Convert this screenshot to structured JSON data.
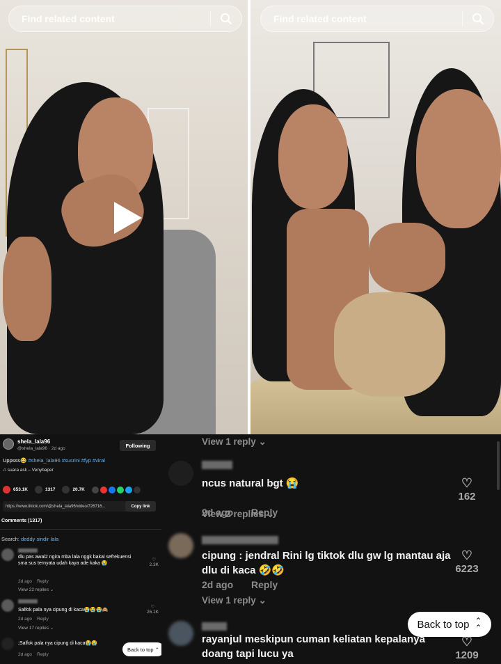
{
  "search": {
    "placeholder": "Find related content"
  },
  "post": {
    "username": "shela_lala96",
    "handle_line": "@shela_lala96 · 2d ago",
    "follow_label": "Following",
    "caption_text": "Uppsss",
    "caption_tags": "#shela_lala96 #susrini #fyp #viral",
    "sound": "suara asli – Venybaper",
    "likes": "653.1K",
    "comments": "1317",
    "saves": "20.7K",
    "link": "https://www.tiktok.com/@shela_lala96/video/726716...",
    "copy_label": "Copy link",
    "comments_heading": "Comments (1317)",
    "search_prefix": "Search:",
    "search_query": "deddy sindir lala"
  },
  "small_comments": [
    {
      "text": "dlu pas awal2 ngira mba lala nggk bakal sefrekuensi sma sus ternyata udah kaya ade kaka 😭",
      "date": "2d ago",
      "reply": "Reply",
      "replies": "View 22 replies ⌄",
      "likes": "2.3K"
    },
    {
      "text": "Salfok pala nya cipung di kaca😭😭😭🙈",
      "date": "2d ago",
      "reply": "Reply",
      "replies": "View 17 replies ⌄",
      "likes": "26.1K"
    },
    {
      "text": ";Salfok pala nya cipung di kaca😭😭",
      "date": "2d ago",
      "reply": "Reply",
      "replies": "",
      "likes": ""
    }
  ],
  "back_to_top_small": "Back to top ⌃",
  "zoom": {
    "top_replies": "View 1 reply ⌄",
    "comments": [
      {
        "text": "ncus natural bgt 😭",
        "date": "2d ago",
        "reply": "Reply",
        "likes": "162",
        "replies": "View 2 replies ⌄"
      },
      {
        "text": "cipung : jendral Rini lg tiktok dlu gw lg mantau aja dlu di kaca 🤣🤣",
        "date": "2d ago",
        "reply": "Reply",
        "likes": "6223",
        "replies": "View 1 reply ⌄"
      },
      {
        "text": "rayanjul meskipun cuman keliatan kepalanya doang tapi lucu ya",
        "date": "",
        "reply": "",
        "likes": "1209",
        "replies": ""
      }
    ],
    "back_to_top": "Back to top"
  }
}
